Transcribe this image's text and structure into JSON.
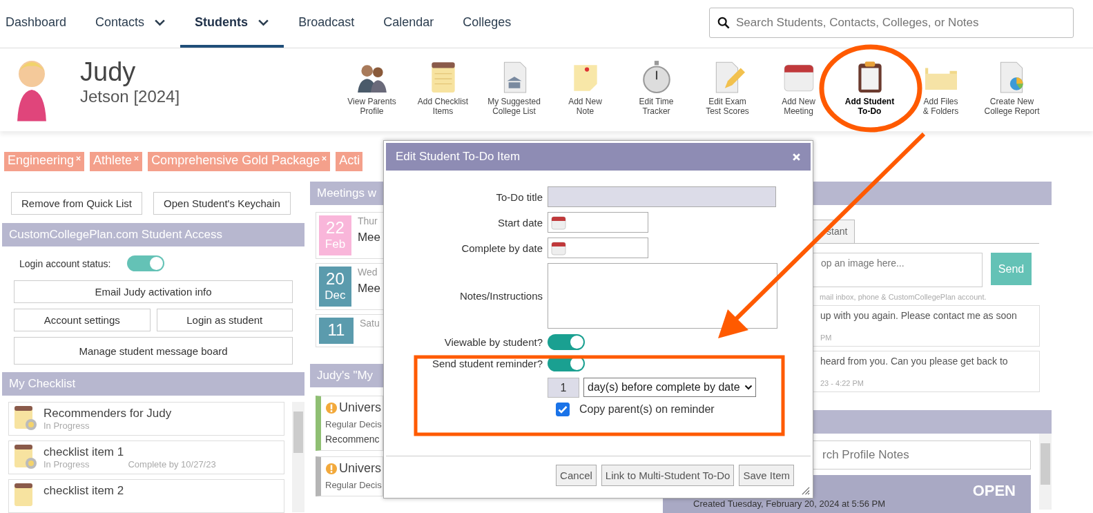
{
  "nav": {
    "items": [
      {
        "label": "Dashboard",
        "selected": false,
        "dropdown": false
      },
      {
        "label": "Contacts",
        "selected": false,
        "dropdown": true
      },
      {
        "label": "Students",
        "selected": true,
        "dropdown": true
      },
      {
        "label": "Broadcast",
        "selected": false,
        "dropdown": false
      },
      {
        "label": "Calendar",
        "selected": false,
        "dropdown": false
      },
      {
        "label": "Colleges",
        "selected": false,
        "dropdown": false
      }
    ],
    "search_placeholder": "Search Students, Contacts, Colleges, or Notes"
  },
  "profile": {
    "first_name": "Judy",
    "last_name": "Jetson [2024]"
  },
  "toolbar": [
    {
      "lines": [
        "View Parents",
        "Profile"
      ],
      "selected": false
    },
    {
      "lines": [
        "Add Checklist",
        "Items"
      ],
      "selected": false
    },
    {
      "lines": [
        "My Suggested",
        "College List"
      ],
      "selected": false
    },
    {
      "lines": [
        "Add New",
        "Note"
      ],
      "selected": false
    },
    {
      "lines": [
        "Edit Time",
        "Tracker"
      ],
      "selected": false
    },
    {
      "lines": [
        "Edit Exam",
        "Test Scores"
      ],
      "selected": false
    },
    {
      "lines": [
        "Add New",
        "Meeting"
      ],
      "selected": false
    },
    {
      "lines": [
        "Add Student",
        "To-Do"
      ],
      "selected": true
    },
    {
      "lines": [
        "Add Files",
        "& Folders"
      ],
      "selected": false
    },
    {
      "lines": [
        "Create New",
        "College Report"
      ],
      "selected": false
    }
  ],
  "tags": [
    {
      "label": "Engineering",
      "removable": true
    },
    {
      "label": "Athlete",
      "removable": true
    },
    {
      "label": "Comprehensive Gold Package",
      "removable": true
    },
    {
      "label": "Acti",
      "removable": false
    }
  ],
  "quick_buttons": [
    "Remove from Quick List",
    "Open Student's Keychain"
  ],
  "student_access": {
    "title": "CustomCollegePlan.com Student Access",
    "status_label": "Login account status:",
    "account_on": true,
    "button_rows": [
      [
        "Email Judy activation info"
      ],
      [
        "Account settings",
        "Login as student"
      ],
      [
        "Manage student message board"
      ]
    ]
  },
  "checklist": {
    "title": "My Checklist",
    "items": [
      {
        "kind": "in_progress",
        "title": "Recommenders for Judy",
        "status": "In Progress"
      },
      {
        "kind": "in_progress",
        "title": "checklist item 1",
        "status": "In Progress",
        "due": "Complete by 10/27/23"
      },
      {
        "kind": "not_started",
        "title": "checklist item 2"
      }
    ]
  },
  "meetings": {
    "title": "Meetings w",
    "items": [
      {
        "day": "22",
        "month": "Feb",
        "color": "#f9b6da",
        "weekday": "Thur",
        "title": "Mee"
      },
      {
        "day": "20",
        "month": "Dec",
        "color": "#5b9bad",
        "weekday": "Wed",
        "title": "Mee"
      },
      {
        "day": "11",
        "color": "#5b9bad",
        "weekday": "Satu"
      }
    ]
  },
  "colleges": {
    "title": "Judy's \"My",
    "items": [
      {
        "color": "#8fbf73",
        "name": "Univers",
        "decision": "Regular Decis",
        "note": "Recommenc"
      },
      {
        "color": "#b5b5b5",
        "name": "Univers",
        "decision": "Regular Decis"
      }
    ]
  },
  "messages": {
    "tab": "stant",
    "placeholder": "op an image here...",
    "send": "Send",
    "hint": "mail inbox, phone & CustomCollegePlan account.",
    "items": [
      {
        "text": "up with you again. Please contact me as soon",
        "time": "PM"
      },
      {
        "text": "heard from you. Can you please get back to",
        "time": "23 - 4:22 PM"
      }
    ]
  },
  "notes": {
    "search_placeholder": "rch Profile Notes",
    "status": "OPEN",
    "created": "Created Tuesday, February 20, 2024 at 5:56 PM"
  },
  "modal": {
    "title": "Edit Student To-Do Item",
    "fields": [
      {
        "kind": "text",
        "label": "To-Do title"
      },
      {
        "kind": "date",
        "label": "Start date"
      },
      {
        "kind": "date",
        "label": "Complete by date"
      },
      {
        "kind": "textarea",
        "label": "Notes/Instructions"
      },
      {
        "kind": "toggle",
        "label": "Viewable by student?",
        "on": true
      },
      {
        "kind": "toggle",
        "label": "Send student reminder?",
        "on": true
      }
    ],
    "reminder": {
      "count": "1",
      "unit": "day(s) before complete by date",
      "copy_label": "Copy parent(s) on reminder",
      "copy_checked": true
    },
    "buttons": [
      "Cancel",
      "Link to Multi-Student To-Do",
      "Save Item"
    ]
  }
}
